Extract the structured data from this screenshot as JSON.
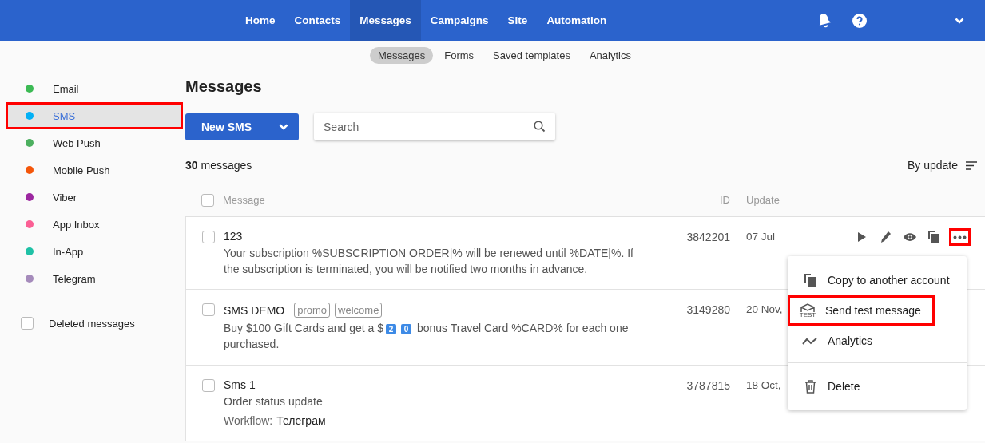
{
  "top_nav": {
    "items": [
      {
        "label": "Home",
        "selected": false
      },
      {
        "label": "Contacts",
        "selected": false
      },
      {
        "label": "Messages",
        "selected": true
      },
      {
        "label": "Campaigns",
        "selected": false
      },
      {
        "label": "Site",
        "selected": false
      },
      {
        "label": "Automation",
        "selected": false
      }
    ]
  },
  "sub_nav": {
    "items": [
      {
        "label": "Messages",
        "selected": true
      },
      {
        "label": "Forms",
        "selected": false
      },
      {
        "label": "Saved templates",
        "selected": false
      },
      {
        "label": "Analytics",
        "selected": false
      }
    ]
  },
  "sidebar": {
    "items": [
      {
        "label": "Email",
        "color": "#3cba54",
        "selected": false,
        "highlighted": false
      },
      {
        "label": "SMS",
        "color": "#03b0f5",
        "selected": true,
        "highlighted": true
      },
      {
        "label": "Web Push",
        "color": "#4caf5f",
        "selected": false,
        "highlighted": false
      },
      {
        "label": "Mobile Push",
        "color": "#f4560a",
        "selected": false,
        "highlighted": false
      },
      {
        "label": "Viber",
        "color": "#9c27a0",
        "selected": false,
        "highlighted": false
      },
      {
        "label": "App Inbox",
        "color": "#fb5f94",
        "selected": false,
        "highlighted": false
      },
      {
        "label": "In-App",
        "color": "#1fc1a6",
        "selected": false,
        "highlighted": false
      },
      {
        "label": "Telegram",
        "color": "#a58bbb",
        "selected": false,
        "highlighted": false
      }
    ],
    "deleted": {
      "label": "Deleted messages",
      "checked": false
    }
  },
  "page_title": "Messages",
  "new_button": {
    "label": "New SMS"
  },
  "search": {
    "placeholder": "Search"
  },
  "count": {
    "number": "30",
    "label": "messages"
  },
  "sort": {
    "label": "By update"
  },
  "table": {
    "columns": [
      "Message",
      "ID",
      "Update"
    ],
    "header_checked": false,
    "rows": [
      {
        "checked": false,
        "title": "123",
        "tags": [],
        "text": "Your subscription %SUBSCRIPTION ORDER|% will be renewed until %DATE|%. If the subscription is terminated, you will be notified two months in advance.",
        "id": "3842201",
        "update": "07 Jul",
        "actions": true
      },
      {
        "checked": false,
        "title": "SMS DEMO",
        "tags": [
          "promo",
          "welcome"
        ],
        "text_before": "Buy $100 Gift Cards and get a $",
        "keycaps": [
          "2",
          "0"
        ],
        "text_after": "bonus Travel Card %CARD% for each one purchased.",
        "id": "3149280",
        "update": "20 Nov,",
        "actions": false
      },
      {
        "checked": false,
        "title": "Sms 1",
        "tags": [],
        "text": "Order status update",
        "workflow": {
          "label": "Workflow:",
          "value": "Телеграм"
        },
        "id": "3787815",
        "update": "18 Oct,",
        "actions": false
      }
    ]
  },
  "more_button": {
    "highlighted": true
  },
  "menu": {
    "items": [
      {
        "kind": "copy",
        "label": "Copy to another account",
        "highlighted": false
      },
      {
        "kind": "test",
        "label": "Send test message",
        "highlighted": true,
        "icon_text": "TEST"
      },
      {
        "kind": "analytics",
        "label": "Analytics",
        "highlighted": false
      },
      {
        "kind": "delete",
        "label": "Delete",
        "highlighted": false
      }
    ]
  }
}
